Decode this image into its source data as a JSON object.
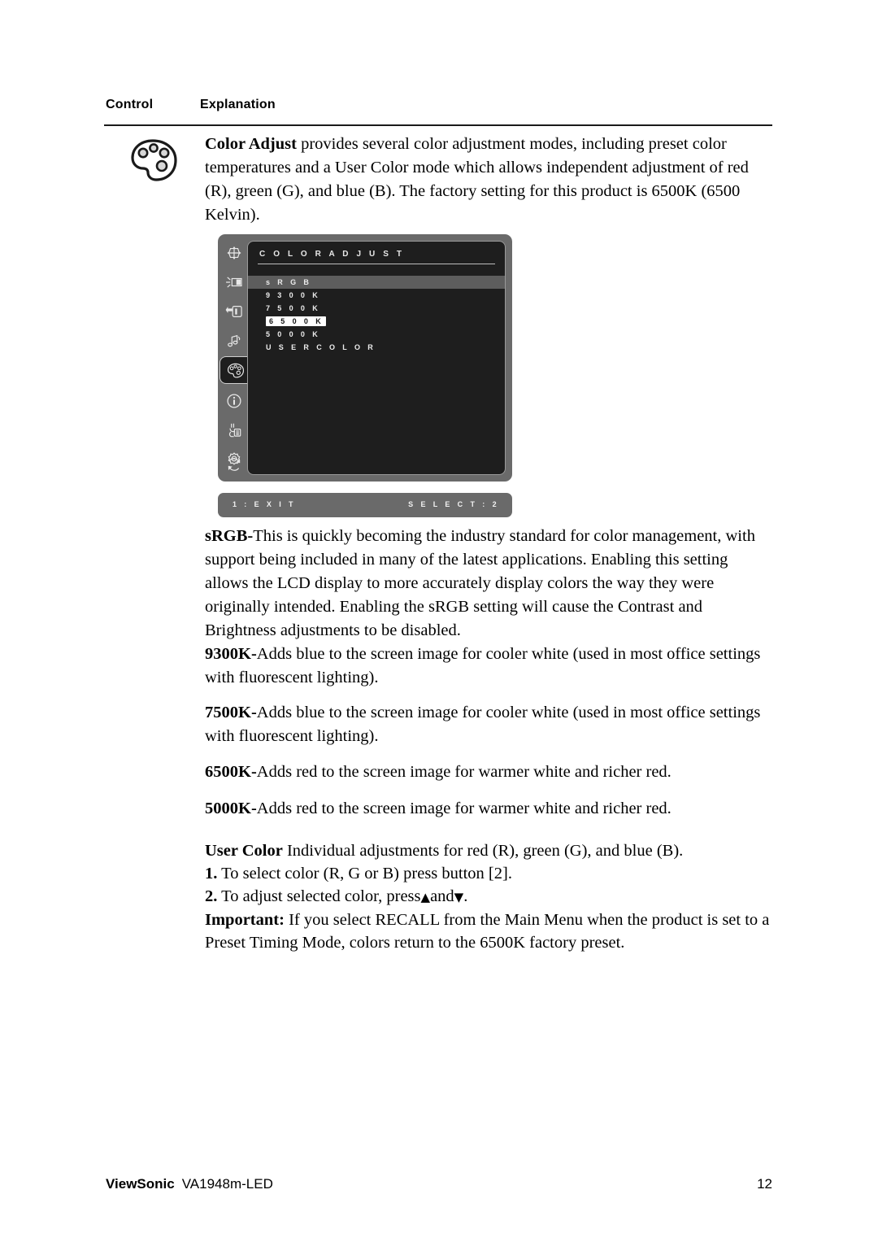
{
  "table_header": {
    "control": "Control",
    "explanation": "Explanation"
  },
  "control_icon": "color-palette-icon",
  "intro": {
    "term": "Color Adjust",
    "text": " provides several color adjustment modes, including preset color temperatures and a User Color mode which allows independent adjustment of red (R), green (G), and blue (B). The factory setting for this product is 6500K (6500 Kelvin)."
  },
  "osd": {
    "title": "C O L O R   A D J U S T",
    "menu_items": [
      {
        "label": "s R G B",
        "state": "row-highlight"
      },
      {
        "label": "9 3 0 0 K",
        "state": "normal"
      },
      {
        "label": "7 5 0 0 K",
        "state": "normal"
      },
      {
        "label": "6 5 0 0 K",
        "state": "boxed-selected"
      },
      {
        "label": "5 0 0 0 K",
        "state": "normal"
      },
      {
        "label": "U S E R   C O L O R",
        "state": "normal"
      }
    ],
    "sidebar_icons": [
      "auto-image-adjust-icon",
      "brightness-contrast-icon",
      "input-select-icon",
      "audio-adjust-icon",
      "color-adjust-icon",
      "information-icon",
      "manual-image-adjust-icon",
      "setup-menu-icon",
      "memory-recall-icon"
    ],
    "selected_sidebar_icon": "color-adjust-icon",
    "status_left": "1 : E X I T",
    "status_right": "S E L E C T : 2",
    "colors": {
      "bezel": "#6a6a6a",
      "screen": "#1e1e1e",
      "row_highlight": "#5d5d5d",
      "selected_box_bg": "#ffffff",
      "text": "#ececec"
    }
  },
  "sections": {
    "srgb": {
      "term": "sRGB-",
      "text": "This is quickly becoming the industry standard for color management, with support being included in many of the latest applications. Enabling this setting allows the LCD display to more accurately display colors the way they were originally intended. Enabling the sRGB setting will cause the Contrast and Brightness adjustments to be disabled."
    },
    "k9300": {
      "term": "9300K-",
      "text": "Adds blue to the screen image for cooler white (used in most office settings with fluorescent lighting)."
    },
    "k7500": {
      "term": "7500K-",
      "text": "Adds blue to the screen image for cooler white (used in most office settings with fluorescent lighting)."
    },
    "k6500": {
      "term": "6500K-",
      "text": "Adds red to the screen image for warmer white and richer red."
    },
    "k5000": {
      "term": "5000K-",
      "text": "Adds red to the screen image for warmer white and richer red."
    },
    "user_color": {
      "term": "User Color",
      "text": "  Individual adjustments for red (R), green (G),  and blue (B).",
      "step1_num": "1.",
      "step1_text": " To select color (R, G or B) press button [2].",
      "step2_num": "2.",
      "step2_text_a": " To adjust selected color, press",
      "step2_up": "▲",
      "step2_text_b": "and",
      "step2_down": "▼",
      "step2_text_c": ".",
      "important_term": "Important:",
      "important_text": " If you select RECALL from the Main Menu when the product is set to a Preset Timing Mode, colors return to the 6500K factory preset."
    }
  },
  "footer": {
    "brand": "ViewSonic",
    "model": "VA1948m-LED",
    "page_number": "12"
  }
}
